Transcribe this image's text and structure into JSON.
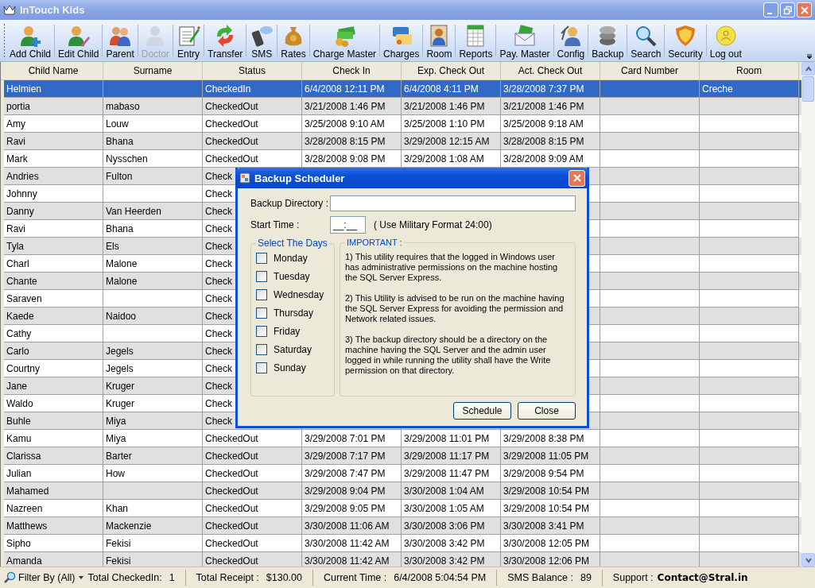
{
  "window": {
    "title": "InTouch Kids"
  },
  "toolbar": [
    {
      "label": "Add Child",
      "disabled": false
    },
    {
      "label": "Edit Child",
      "disabled": false
    },
    {
      "label": "Parent",
      "disabled": false
    },
    {
      "label": "Doctor",
      "disabled": true
    },
    {
      "label": "Entry",
      "disabled": false
    },
    {
      "label": "Transfer",
      "disabled": false
    },
    {
      "label": "SMS",
      "disabled": false
    },
    {
      "label": "Rates",
      "disabled": false
    },
    {
      "label": "Charge Master",
      "disabled": false
    },
    {
      "label": "Charges",
      "disabled": false
    },
    {
      "label": "Room",
      "disabled": false
    },
    {
      "label": "Reports",
      "disabled": false
    },
    {
      "label": "Pay. Master",
      "disabled": false
    },
    {
      "label": "Config",
      "disabled": false
    },
    {
      "label": "Backup",
      "disabled": false
    },
    {
      "label": "Search",
      "disabled": false
    },
    {
      "label": "Security",
      "disabled": false
    },
    {
      "label": "Log out",
      "disabled": false
    }
  ],
  "table": {
    "columns": [
      "Child Name",
      "Surname",
      "Status",
      "Check In",
      "Exp. Check Out",
      "Act. Check Out",
      "Card Number",
      "Room"
    ],
    "rows": [
      {
        "selected": true,
        "cells": [
          "Helmien",
          "",
          "CheckedIn",
          "6/4/2008 12:11 PM",
          "6/4/2008 4:11 PM",
          "3/28/2008 7:37 PM",
          "",
          "Creche"
        ]
      },
      {
        "selected": false,
        "cells": [
          "portia",
          "mabaso",
          "CheckedOut",
          "3/21/2008 1:46 PM",
          "3/21/2008 1:46 PM",
          "3/21/2008 1:46 PM"
        ]
      },
      {
        "selected": false,
        "cells": [
          "Amy",
          "Louw",
          "CheckedOut",
          "3/25/2008 9:10 AM",
          "3/25/2008 1:10 PM",
          "3/25/2008 9:18 AM"
        ]
      },
      {
        "selected": false,
        "cells": [
          "Ravi",
          "Bhana",
          "CheckedOut",
          "3/28/2008 8:15 PM",
          "3/29/2008 12:15 AM",
          "3/28/2008 8:15 PM"
        ]
      },
      {
        "selected": false,
        "cells": [
          "Mark",
          "Nysschen",
          "CheckedOut",
          "3/28/2008 9:08 PM",
          "3/29/2008 1:08 AM",
          "3/28/2008 9:09 AM"
        ]
      },
      {
        "selected": false,
        "cells": [
          "Andries",
          "Fulton",
          "Check"
        ]
      },
      {
        "selected": false,
        "cells": [
          "Johnny",
          "",
          "Check"
        ]
      },
      {
        "selected": false,
        "cells": [
          "Danny",
          "Van Heerden",
          "Check"
        ]
      },
      {
        "selected": false,
        "cells": [
          "Ravi",
          "Bhana",
          "Check"
        ]
      },
      {
        "selected": false,
        "cells": [
          "Tyla",
          "Els",
          "Check"
        ]
      },
      {
        "selected": false,
        "cells": [
          "Charl",
          "Malone",
          "Check"
        ]
      },
      {
        "selected": false,
        "cells": [
          "Chante",
          "Malone",
          "Check"
        ]
      },
      {
        "selected": false,
        "cells": [
          "Saraven",
          "",
          "Check"
        ]
      },
      {
        "selected": false,
        "cells": [
          "Kaede",
          "Naidoo",
          "Check"
        ]
      },
      {
        "selected": false,
        "cells": [
          "Cathy",
          "",
          "Check"
        ]
      },
      {
        "selected": false,
        "cells": [
          "Carlo",
          "Jegels",
          "Check"
        ]
      },
      {
        "selected": false,
        "cells": [
          "Courtny",
          "Jegels",
          "Check"
        ]
      },
      {
        "selected": false,
        "cells": [
          "Jane",
          "Kruger",
          "Check"
        ]
      },
      {
        "selected": false,
        "cells": [
          "Waldo",
          "Kruger",
          "Check"
        ]
      },
      {
        "selected": false,
        "cells": [
          "Buhle",
          "Miya",
          "Check"
        ]
      },
      {
        "selected": false,
        "cells": [
          "Kamu",
          "Miya",
          "CheckedOut",
          "3/29/2008 7:01 PM",
          "3/29/2008 11:01 PM",
          "3/29/2008 8:38 PM"
        ]
      },
      {
        "selected": false,
        "cells": [
          "Clarissa",
          "Barter",
          "CheckedOut",
          "3/29/2008 7:17 PM",
          "3/29/2008 11:17 PM",
          "3/29/2008 11:05 PM"
        ]
      },
      {
        "selected": false,
        "cells": [
          "Julian",
          "How",
          "CheckedOut",
          "3/29/2008 7:47 PM",
          "3/29/2008 11:47 PM",
          "3/29/2008 9:54 PM"
        ]
      },
      {
        "selected": false,
        "cells": [
          "Mahamed",
          "",
          "CheckedOut",
          "3/29/2008 9:04 PM",
          "3/30/2008 1:04 AM",
          "3/29/2008 10:54 PM"
        ]
      },
      {
        "selected": false,
        "cells": [
          "Nazreen",
          "Khan",
          "CheckedOut",
          "3/29/2008 9:05 PM",
          "3/30/2008 1:05 AM",
          "3/29/2008 10:54 PM"
        ]
      },
      {
        "selected": false,
        "cells": [
          "Matthews",
          "Mackenzie",
          "CheckedOut",
          "3/30/2008 11:06 AM",
          "3/30/2008 3:06 PM",
          "3/30/2008 3:41 PM"
        ]
      },
      {
        "selected": false,
        "cells": [
          "Sipho",
          "Fekisi",
          "CheckedOut",
          "3/30/2008 11:42 AM",
          "3/30/2008 3:42 PM",
          "3/30/2008 12:05 PM"
        ]
      },
      {
        "selected": false,
        "cells": [
          "Amanda",
          "Fekisi",
          "CheckedOut",
          "3/30/2008 11:42 AM",
          "3/30/2008 3:42 PM",
          "3/30/2008 12:06 PM"
        ]
      }
    ]
  },
  "dialog": {
    "title": "Backup Scheduler",
    "directory_label": "Backup Directory :",
    "start_time_label": "Start Time :",
    "start_time_value": "__:__",
    "time_hint": "( Use Military Format 24:00)",
    "days_title": "Select The Days",
    "days": [
      {
        "label": "Monday",
        "checked": false
      },
      {
        "label": "Tuesday",
        "checked": false
      },
      {
        "label": "Wednesday",
        "checked": false
      },
      {
        "label": "Thursday",
        "checked": false
      },
      {
        "label": "Friday",
        "checked": false
      },
      {
        "label": "Saturday",
        "checked": false
      },
      {
        "label": "Sunday",
        "checked": false
      }
    ],
    "important_title": "IMPORTANT :",
    "notes": [
      "1) This utility requires that the logged in Windows user has administrative permissions on the machine hosting the SQL Server Express.",
      "2) This Utility is advised to be run on the machine having the SQL Server Express for avoiding the permission and Network related issues.",
      "3) The backup directory should be a directory on the machine having the SQL Server and the admin user logged in while running the utility shall have the Write permission on that directory."
    ],
    "buttons": [
      "Schedule",
      "Close"
    ]
  },
  "status_bar": {
    "filter": "Filter By (All)",
    "checked_in_label": "Total CheckedIn:",
    "checked_in": "1",
    "receipt_label": "Total Receipt :",
    "receipt": "$130.00",
    "time_label": "Current Time :",
    "time": "6/4/2008 5:04:54 PM",
    "sms_label": "SMS Balance :",
    "sms": "89",
    "support_label": "Support :",
    "support": "Contact@Stral.in"
  }
}
